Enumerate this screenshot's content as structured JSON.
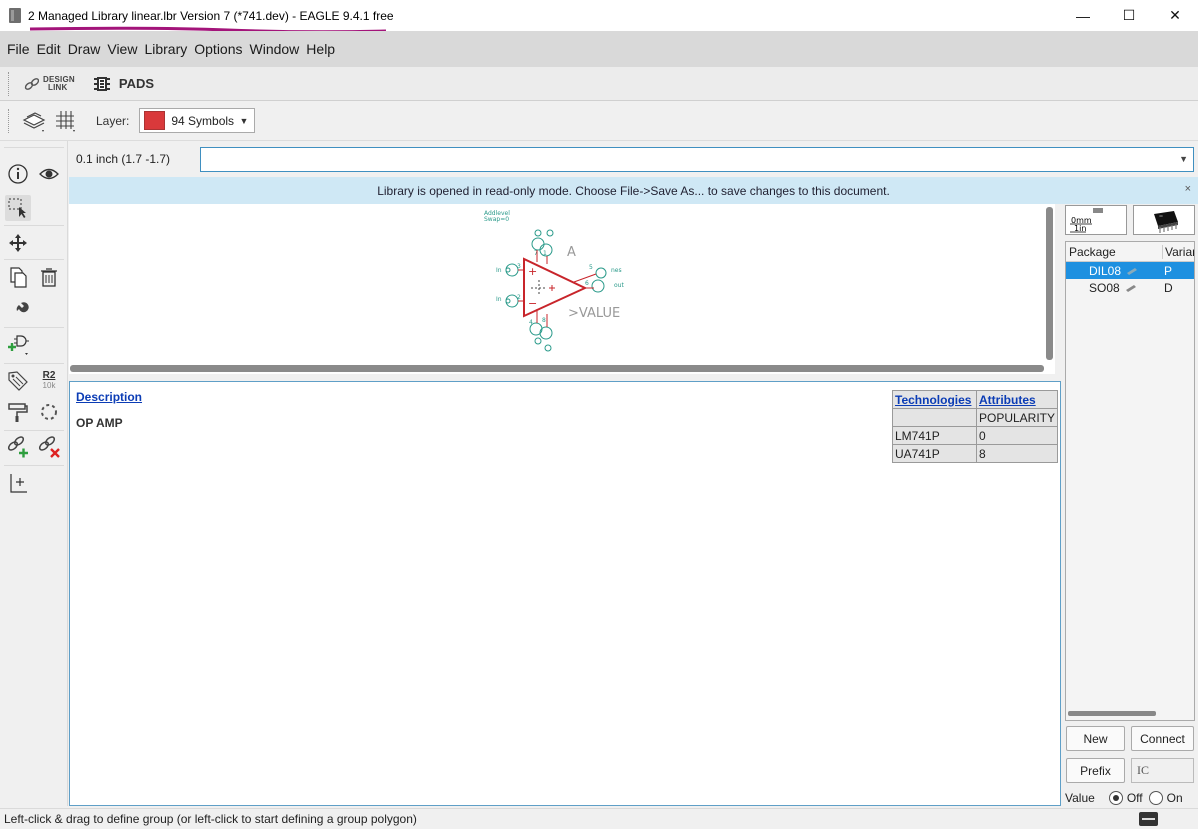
{
  "window": {
    "title": "2 Managed Library linear.lbr Version 7 (*741.dev) - EAGLE 9.4.1 free",
    "minimize": "—",
    "maximize": "☐",
    "close": "✕"
  },
  "menu": [
    "File",
    "Edit",
    "Draw",
    "View",
    "Library",
    "Options",
    "Window",
    "Help"
  ],
  "toolbar1": {
    "design_link_line1": "DESIGN",
    "design_link_line2": "LINK",
    "pads_label": "PADS"
  },
  "toolbar2": {
    "layer_label": "Layer:",
    "layer_value": "94 Symbols",
    "layer_color": "#d9393b"
  },
  "command": {
    "coords": "0.1 inch (1.7 -1.7)",
    "value": ""
  },
  "banner": {
    "text": "Library is opened in read-only mode. Choose File->Save As... to save changes to this document.",
    "close": "×"
  },
  "symbol": {
    "name_label": "A",
    "value_label": ">VALUE",
    "addlevel": "Addlevel",
    "swaplevel": "Swap=0",
    "accent": "#c8252b",
    "pin_color": "#2a9a8a"
  },
  "description": {
    "link": "Description",
    "body": "OP AMP"
  },
  "tech_table": {
    "headers": [
      "Technologies",
      "Attributes"
    ],
    "subheader": [
      "",
      "POPULARITY"
    ],
    "rows": [
      [
        "LM741P",
        "0"
      ],
      [
        "UA741P",
        "8"
      ]
    ]
  },
  "packages": {
    "col1": "Package",
    "col2": "Variant",
    "rows": [
      {
        "name": "DIL08",
        "variant": "P",
        "selected": true
      },
      {
        "name": "SO08",
        "variant": "D",
        "selected": false
      }
    ]
  },
  "right_buttons": {
    "new": "New",
    "connect": "Connect",
    "prefix": "Prefix",
    "prefix_value": "IC",
    "value_label": "Value",
    "off": "Off",
    "on": "On",
    "value_mode": "Off"
  },
  "status": {
    "text": "Left-click & drag to define group (or left-click to start defining a group polygon)"
  }
}
